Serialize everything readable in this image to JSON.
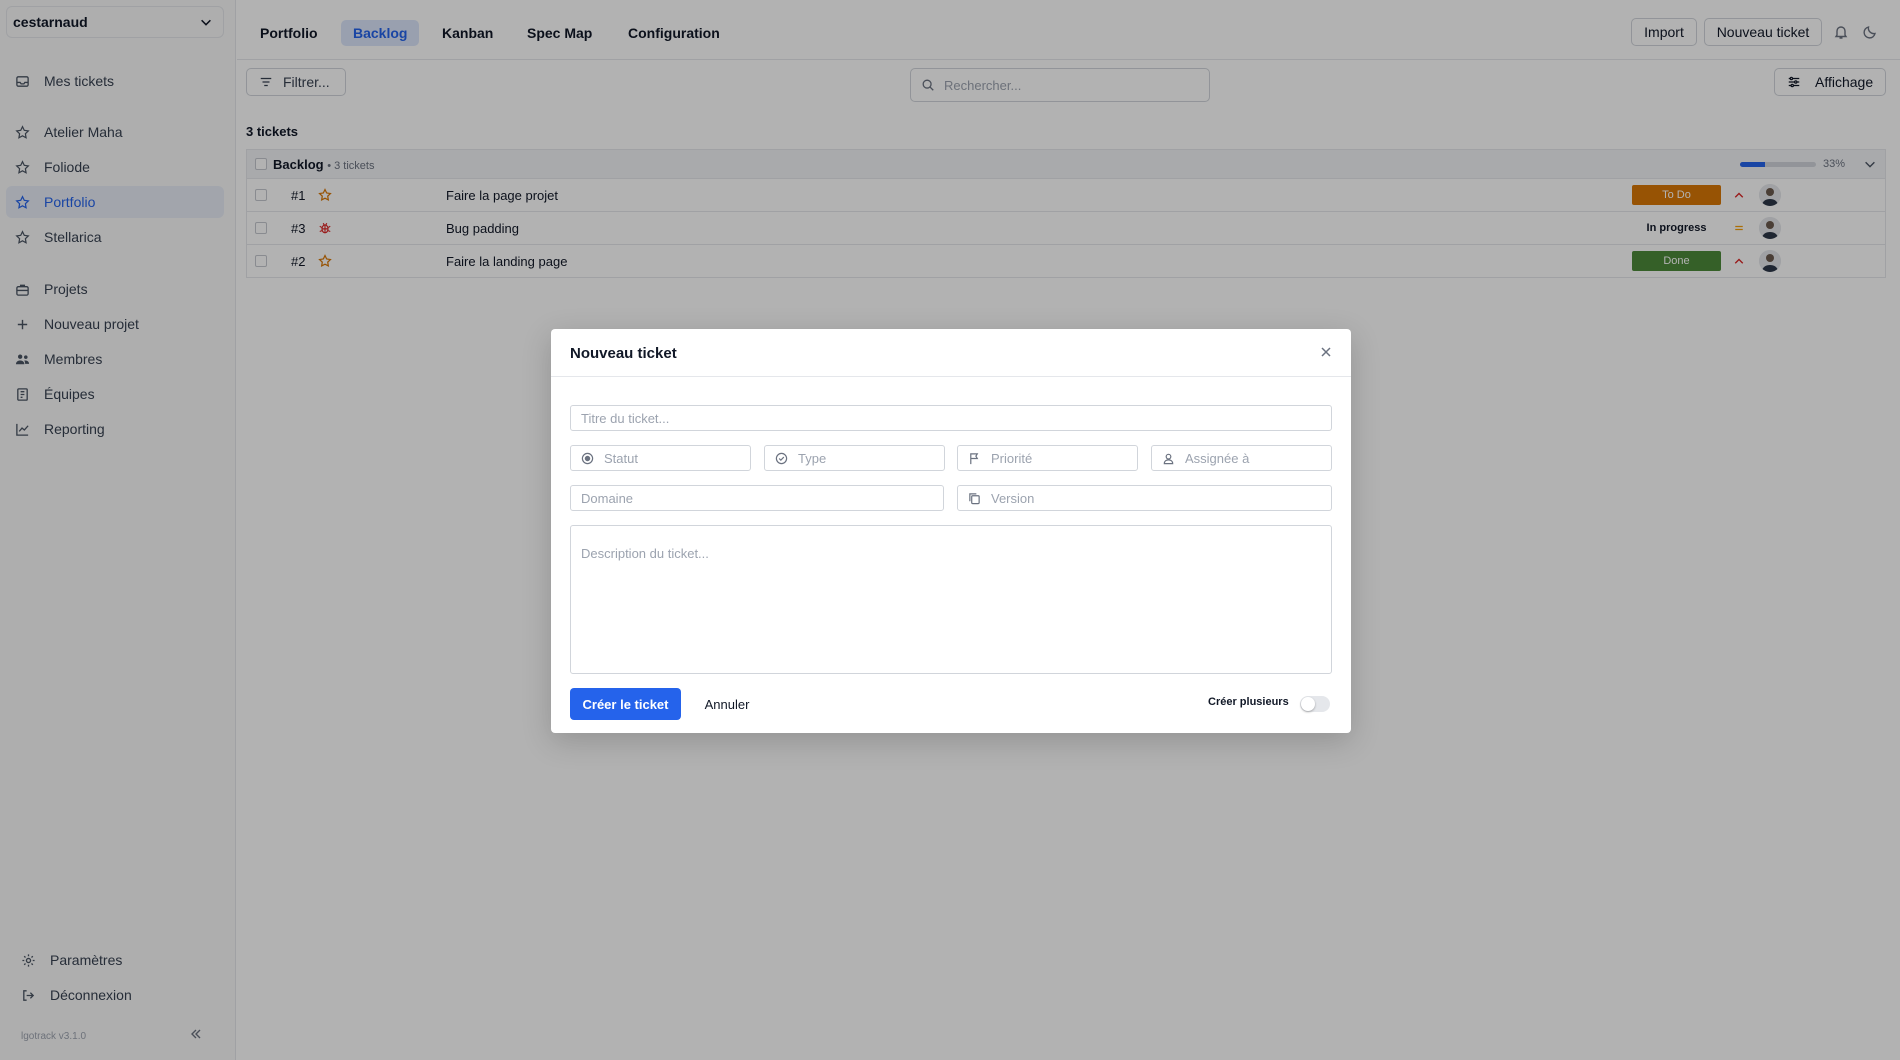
{
  "sidebar": {
    "workspace": "cestarnaud",
    "items": [
      {
        "label": "Mes tickets",
        "icon": "inbox-icon"
      },
      {
        "label": "Atelier Maha",
        "icon": "star-icon"
      },
      {
        "label": "Foliode",
        "icon": "star-icon"
      },
      {
        "label": "Portfolio",
        "icon": "star-icon",
        "active": true
      },
      {
        "label": "Stellarica",
        "icon": "star-icon"
      },
      {
        "label": "Projets",
        "icon": "briefcase-icon"
      },
      {
        "label": "Nouveau projet",
        "icon": "plus-icon"
      },
      {
        "label": "Membres",
        "icon": "users-icon"
      },
      {
        "label": "Équipes",
        "icon": "book-icon"
      },
      {
        "label": "Reporting",
        "icon": "chart-line-icon"
      }
    ],
    "footer": [
      {
        "label": "Paramètres",
        "icon": "gear-icon"
      },
      {
        "label": "Déconnexion",
        "icon": "logout-icon"
      }
    ],
    "version": "lgotrack v3.1.0"
  },
  "topbar": {
    "tabs": [
      {
        "label": "Portfolio"
      },
      {
        "label": "Backlog",
        "active": true
      },
      {
        "label": "Kanban"
      },
      {
        "label": "Spec Map"
      },
      {
        "label": "Configuration"
      }
    ],
    "import_label": "Import",
    "new_ticket_label": "Nouveau ticket"
  },
  "toolbar": {
    "filter_label": "Filtrer...",
    "search_placeholder": "Rechercher...",
    "display_label": "Affichage"
  },
  "backlog": {
    "count_label": "3 tickets",
    "group": {
      "title": "Backlog",
      "subtitle": "• 3 tickets",
      "progress": 0.33,
      "progress_label": "33%"
    },
    "rows": [
      {
        "id": "#1",
        "type_icon": "star-icon",
        "title": "Faire la page projet",
        "status": "To Do",
        "status_color": "#d97706",
        "priority_icon": "chevron-up-icon"
      },
      {
        "id": "#3",
        "type_icon": "bug-icon",
        "title": "Bug padding",
        "status": "In progress",
        "status_color": "#9ca3af",
        "priority_icon": "equals-icon"
      },
      {
        "id": "#2",
        "type_icon": "star-icon",
        "title": "Faire la landing page",
        "status": "Done",
        "status_color": "#4d8a3a",
        "priority_icon": "chevron-up-icon"
      }
    ]
  },
  "modal": {
    "title": "Nouveau ticket",
    "title_placeholder": "Titre du ticket...",
    "statut_placeholder": "Statut",
    "type_placeholder": "Type",
    "priorite_placeholder": "Priorité",
    "assignee_placeholder": "Assignée à",
    "domaine_placeholder": "Domaine",
    "version_placeholder": "Version",
    "description_placeholder": "Description du ticket...",
    "create_label": "Créer le ticket",
    "cancel_label": "Annuler",
    "multi_label": "Créer plusieurs",
    "multi_enabled": false
  },
  "colors": {
    "accent": "#2563eb",
    "todo": "#d97706",
    "done": "#4d8a3a",
    "priority_high": "#dc2626",
    "priority_medium": "#f59e0b"
  }
}
